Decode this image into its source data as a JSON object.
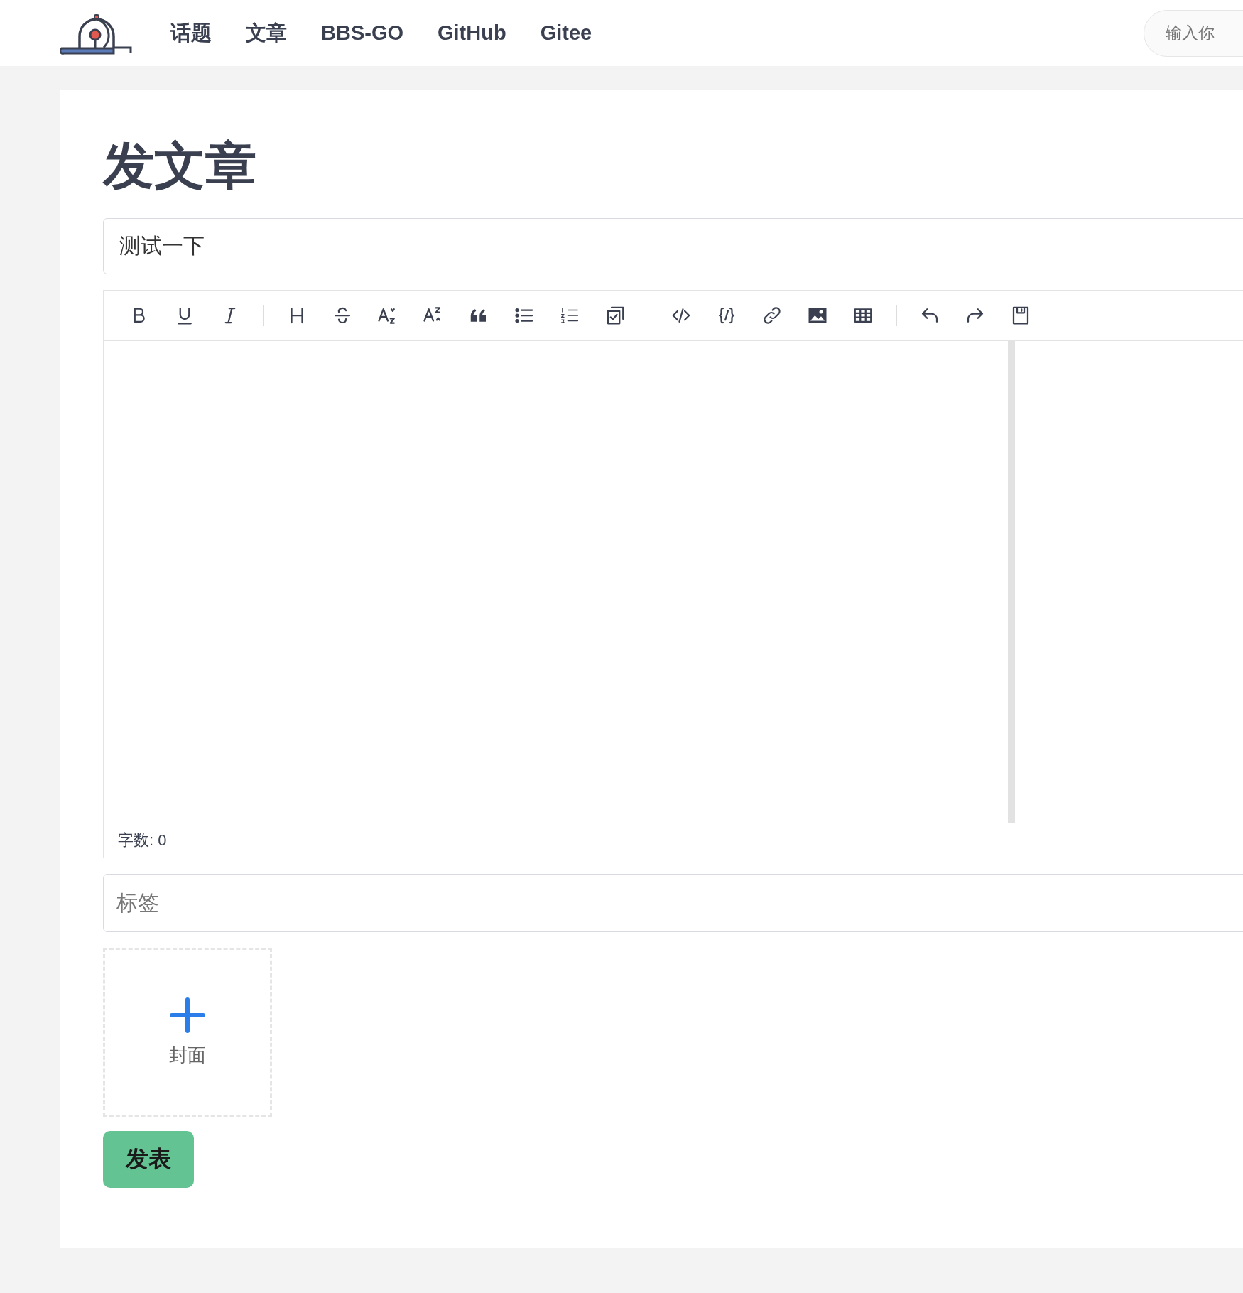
{
  "header": {
    "nav_items": [
      {
        "label": "话题"
      },
      {
        "label": "文章"
      },
      {
        "label": "BBS-GO"
      },
      {
        "label": "GitHub"
      },
      {
        "label": "Gitee"
      }
    ],
    "search": {
      "placeholder": "输入你"
    }
  },
  "page": {
    "title": "发文章",
    "title_input": {
      "value": "测试一下"
    },
    "editor": {
      "word_count": "字数: 0"
    },
    "tags_input": {
      "placeholder": "标签"
    },
    "cover_upload": {
      "label": "封面"
    },
    "publish_button": {
      "label": "发表"
    }
  }
}
